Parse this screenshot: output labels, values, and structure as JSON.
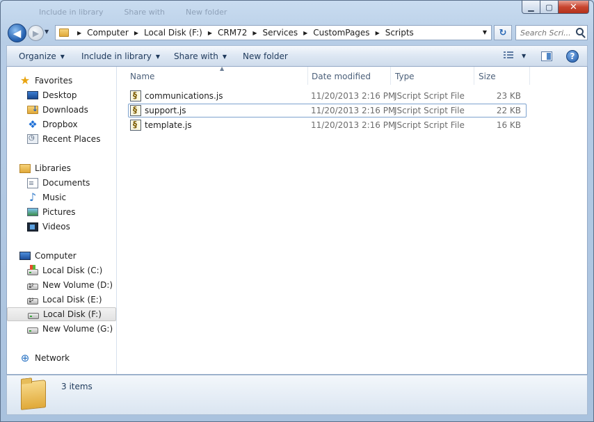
{
  "window": {
    "ghost_menu": [
      "Include in library",
      "Share with",
      "New folder"
    ],
    "controls": {
      "minimize": "▁",
      "maximize": "▢",
      "close": "✕"
    }
  },
  "nav": {
    "back_glyph": "◀",
    "forward_glyph": "▶",
    "address": {
      "crumbs": [
        "Computer",
        "Local Disk (F:)",
        "CRM72",
        "Services",
        "CustomPages",
        "Scripts"
      ]
    },
    "refresh_glyph": "↻",
    "search": {
      "placeholder": "Search Scri..."
    }
  },
  "toolbar": {
    "organize": "Organize",
    "include_in_library": "Include in library",
    "share_with": "Share with",
    "new_folder": "New folder",
    "help": "?"
  },
  "navpane": {
    "favorites": {
      "label": "Favorites",
      "icon": "star-icon"
    },
    "favorite_items": [
      {
        "label": "Desktop",
        "icon": "desktop-icon"
      },
      {
        "label": "Downloads",
        "icon": "downloads-folder-icon"
      },
      {
        "label": "Dropbox",
        "icon": "dropbox-icon"
      },
      {
        "label": "Recent Places",
        "icon": "recent-places-icon"
      }
    ],
    "libraries": {
      "label": "Libraries",
      "icon": "libraries-icon"
    },
    "library_items": [
      {
        "label": "Documents",
        "icon": "documents-icon"
      },
      {
        "label": "Music",
        "icon": "music-icon"
      },
      {
        "label": "Pictures",
        "icon": "pictures-icon"
      },
      {
        "label": "Videos",
        "icon": "videos-icon"
      }
    ],
    "computer": {
      "label": "Computer",
      "icon": "computer-icon"
    },
    "drives": [
      {
        "label": "Local Disk (C:)",
        "icon": "windows-drive-icon"
      },
      {
        "label": "New Volume (D:)",
        "icon": "hard-drive-icon"
      },
      {
        "label": "Local Disk (E:)",
        "icon": "hard-drive-icon"
      },
      {
        "label": "Local Disk (F:)",
        "icon": "removable-drive-icon",
        "selected": true
      },
      {
        "label": "New Volume (G:)",
        "icon": "removable-drive-icon"
      }
    ],
    "network": {
      "label": "Network",
      "icon": "network-icon"
    }
  },
  "filelist": {
    "columns": [
      "Name",
      "Date modified",
      "Type",
      "Size"
    ],
    "sorted_column": "Name",
    "files": [
      {
        "name": "communications.js",
        "date": "11/20/2013 2:16 PM",
        "type": "JScript Script File",
        "size": "23 KB"
      },
      {
        "name": "support.js",
        "date": "11/20/2013 2:16 PM",
        "type": "JScript Script File",
        "size": "22 KB"
      },
      {
        "name": "template.js",
        "date": "11/20/2013 2:16 PM",
        "type": "JScript Script File",
        "size": "16 KB"
      }
    ],
    "focused_index": 1
  },
  "details": {
    "items_count": "3 items"
  },
  "colors": {
    "accent": "#1e395b",
    "selection_border": "#7da2ce",
    "window_frame": "#b7cde6"
  }
}
